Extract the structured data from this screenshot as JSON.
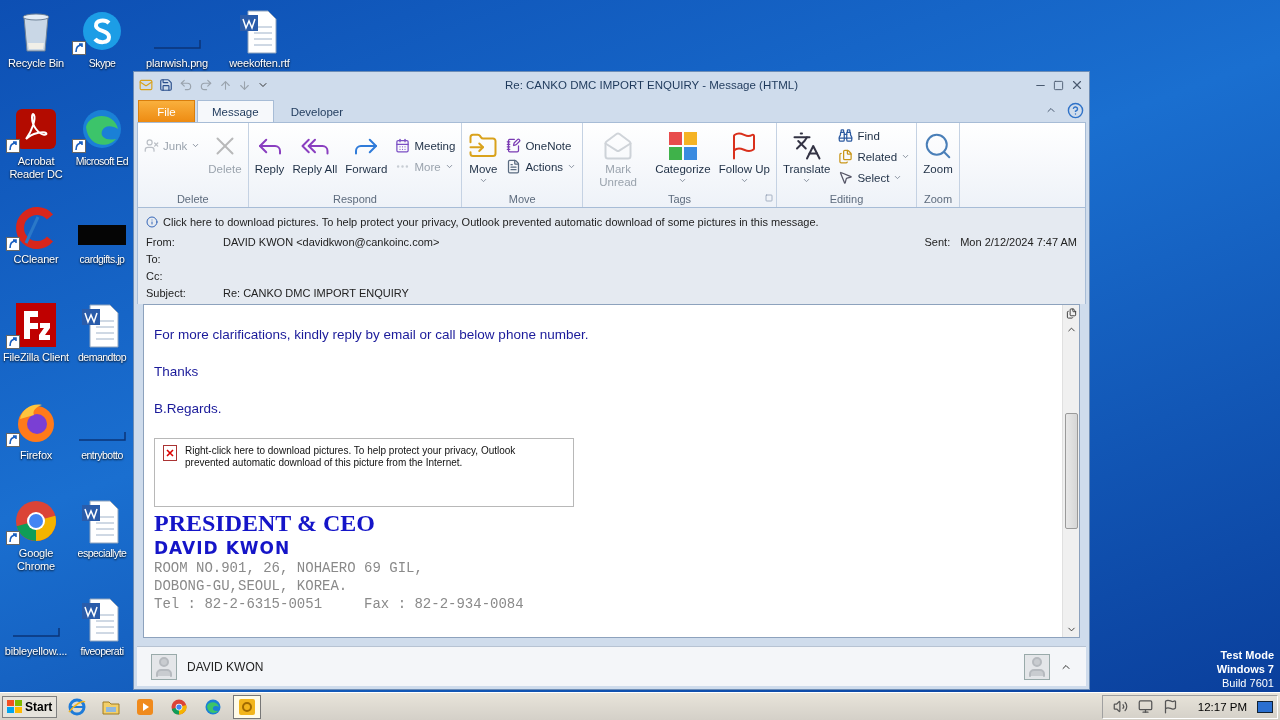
{
  "desktop": {
    "columns": [
      [
        {
          "label": "Recycle Bin",
          "shortcut": false
        },
        {
          "label": "Acrobat Reader DC",
          "shortcut": true
        },
        {
          "label": "CCleaner",
          "shortcut": true
        },
        {
          "label": "FileZilla Client",
          "shortcut": true
        },
        {
          "label": "Firefox",
          "shortcut": true
        },
        {
          "label": "Google Chrome",
          "shortcut": true
        },
        {
          "label": "bibleyellow....",
          "shortcut": false
        }
      ],
      [
        {
          "label": "Skype",
          "shortcut": true
        },
        {
          "label": "Microsoft Ed",
          "shortcut": true
        },
        {
          "label": "cardgifts.jp",
          "shortcut": false
        },
        {
          "label": "demandtop",
          "shortcut": false
        },
        {
          "label": "entrybotto",
          "shortcut": false
        },
        {
          "label": "especiallyte",
          "shortcut": false
        },
        {
          "label": "fiveoperati",
          "shortcut": false
        }
      ],
      [
        {
          "label": "planwish.png",
          "shortcut": false
        }
      ],
      [
        {
          "label": "weekoften.rtf",
          "shortcut": false
        }
      ]
    ],
    "os_text": [
      "Test Mode",
      "Windows 7",
      "Build 7601"
    ]
  },
  "window": {
    "title": "Re: CANKO DMC IMPORT ENQUIRY -  Message (HTML)",
    "tabs": [
      {
        "label": "File",
        "kind": "file",
        "selected": false
      },
      {
        "label": "Message",
        "kind": "tab",
        "selected": true
      },
      {
        "label": "Developer",
        "kind": "tab",
        "selected": false
      }
    ],
    "ribbon": [
      {
        "label": "Delete",
        "items": [
          {
            "label": "Junk",
            "kind": "small",
            "disabled": true,
            "dropdown": true
          },
          {
            "label": "Delete",
            "kind": "large",
            "disabled": true,
            "dropdown": false
          }
        ]
      },
      {
        "label": "Respond",
        "items": [
          {
            "label": "Reply",
            "kind": "large",
            "disabled": false,
            "dropdown": false
          },
          {
            "label": "Reply All",
            "kind": "large",
            "disabled": false,
            "dropdown": false
          },
          {
            "label": "Forward",
            "kind": "large",
            "disabled": false,
            "dropdown": false
          },
          {
            "label": "Meeting",
            "kind": "small",
            "disabled": false,
            "dropdown": false
          },
          {
            "label": "More",
            "kind": "small",
            "disabled": true,
            "dropdown": true
          }
        ]
      },
      {
        "label": "Move",
        "items": [
          {
            "label": "Move",
            "kind": "large",
            "disabled": false,
            "dropdown": true
          },
          {
            "label": "OneNote",
            "kind": "small",
            "disabled": false,
            "dropdown": false
          },
          {
            "label": "Actions",
            "kind": "small",
            "disabled": false,
            "dropdown": true
          }
        ]
      },
      {
        "label": "Tags",
        "launcher": true,
        "items": [
          {
            "label": "Mark Unread",
            "kind": "large",
            "disabled": true,
            "dropdown": false
          },
          {
            "label": "Categorize",
            "kind": "large",
            "disabled": false,
            "dropdown": true
          },
          {
            "label": "Follow Up",
            "kind": "large",
            "disabled": false,
            "dropdown": true
          }
        ]
      },
      {
        "label": "Editing",
        "items": [
          {
            "label": "Translate",
            "kind": "large",
            "disabled": false,
            "dropdown": true
          },
          {
            "label": "Find",
            "kind": "small",
            "disabled": false,
            "dropdown": false
          },
          {
            "label": "Related",
            "kind": "small",
            "disabled": false,
            "dropdown": true
          },
          {
            "label": "Select",
            "kind": "small",
            "disabled": false,
            "dropdown": true
          }
        ]
      },
      {
        "label": "Zoom",
        "items": [
          {
            "label": "Zoom",
            "kind": "large",
            "disabled": false,
            "dropdown": false
          }
        ]
      }
    ],
    "info_bar": "Click here to download pictures. To help protect your privacy, Outlook prevented automatic download of some pictures in this message.",
    "header": {
      "fields": [
        {
          "label": "From:",
          "value": "DAVID KWON <davidkwon@cankoinc.com>"
        },
        {
          "label": "To:"
        },
        {
          "label": "Cc:"
        },
        {
          "label": "Subject:",
          "value": "Re: CANKO DMC IMPORT ENQUIRY"
        }
      ],
      "sent_label": "Sent:",
      "sent_value": "Mon 2/12/2024 7:47 AM"
    },
    "body": [
      {
        "kind": "paragraph",
        "text": "For more clarifications, kindly reply by email or call below phone number."
      },
      {
        "kind": "paragraph",
        "text": "Thanks"
      },
      {
        "kind": "paragraph",
        "text": "B.Regards."
      },
      {
        "kind": "blocked_image",
        "text": "Right-click here to download pictures.  To help protect your privacy, Outlook prevented automatic download of this picture from the Internet."
      },
      {
        "kind": "sig_title",
        "text": "PRESIDENT & CEO"
      },
      {
        "kind": "sig_name",
        "text": "DAVID KWON"
      },
      {
        "kind": "address",
        "text": "ROOM NO.901, 26, NOHAERO 69 GIL,"
      },
      {
        "kind": "address",
        "text": "DOBONG-GU,SEOUL, KOREA."
      },
      {
        "kind": "address",
        "text": "Tel : 82-2-6315-0051     Fax : 82-2-934-0084"
      }
    ],
    "people_pane": {
      "name": "DAVID KWON"
    }
  },
  "taskbar": {
    "start": "Start",
    "apps": [
      {
        "selected": false
      },
      {
        "selected": false
      },
      {
        "selected": false
      },
      {
        "selected": false
      },
      {
        "selected": false
      },
      {
        "selected": true
      }
    ],
    "clock": "12:17 PM"
  }
}
